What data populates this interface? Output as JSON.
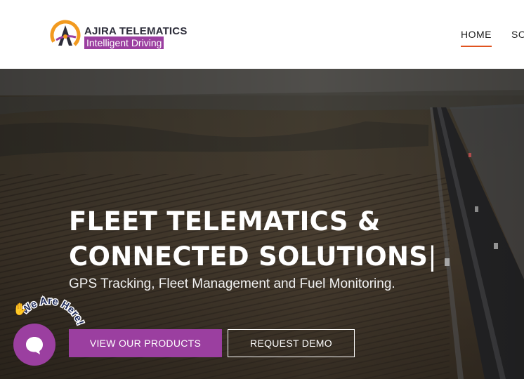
{
  "header": {
    "brand_name": "AJIRA TELEMATICS",
    "brand_tagline": "Intelligent Driving",
    "nav": {
      "home": "HOME",
      "next_partial": "SO"
    }
  },
  "hero": {
    "headline_line1": "FLEET TELEMATICS &",
    "headline_line2": "CONNECTED SOLUTIONS",
    "typing_cursor": "|",
    "subheadline": "GPS Tracking, Fleet Management and Fuel Monitoring.",
    "primary_button": "VIEW OUR PRODUCTS",
    "secondary_button": "REQUEST DEMO"
  },
  "chat_widget": {
    "badge_text": "We Are Here!",
    "wave_icon": "✋"
  },
  "colors": {
    "brand_purple": "#9b3fa0",
    "nav_underline": "#e0531f",
    "logo_orange": "#f29a1f",
    "text_dark": "#1d1d1d"
  },
  "icons": [
    "ajira-logo-icon",
    "chat-icon",
    "wave-hand-icon"
  ]
}
